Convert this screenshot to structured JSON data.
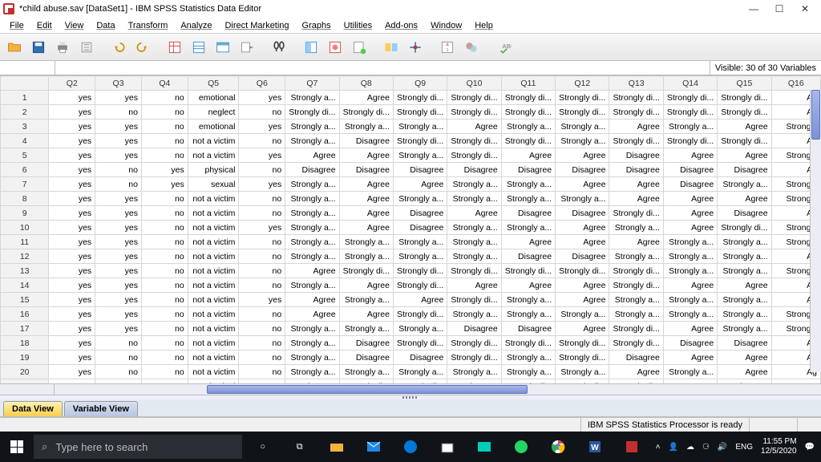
{
  "title": "*child abuse.sav [DataSet1] - IBM SPSS Statistics Data Editor",
  "menu": [
    "File",
    "Edit",
    "View",
    "Data",
    "Transform",
    "Analyze",
    "Direct Marketing",
    "Graphs",
    "Utilities",
    "Add-ons",
    "Window",
    "Help"
  ],
  "visible_text": "Visible: 30 of 30 Variables",
  "columns": [
    "Q2",
    "Q3",
    "Q4",
    "Q5",
    "Q6",
    "Q7",
    "Q8",
    "Q9",
    "Q10",
    "Q11",
    "Q12",
    "Q13",
    "Q14",
    "Q15",
    "Q16"
  ],
  "rows": [
    [
      "yes",
      "yes",
      "no",
      "emotional",
      "yes",
      "Strongly a...",
      "Agree",
      "Strongly di...",
      "Strongly di...",
      "Strongly di...",
      "Strongly di...",
      "Strongly di...",
      "Strongly di...",
      "Strongly di...",
      "Ag"
    ],
    [
      "yes",
      "no",
      "no",
      "neglect",
      "no",
      "Strongly di...",
      "Strongly di...",
      "Strongly di...",
      "Strongly di...",
      "Strongly di...",
      "Strongly di...",
      "Strongly di...",
      "Strongly di...",
      "Strongly di...",
      "Ag"
    ],
    [
      "yes",
      "yes",
      "no",
      "emotional",
      "yes",
      "Strongly a...",
      "Strongly a...",
      "Strongly a...",
      "Agree",
      "Strongly a...",
      "Strongly a...",
      "Agree",
      "Strongly a...",
      "Agree",
      "Strongly"
    ],
    [
      "yes",
      "yes",
      "no",
      "not a victim",
      "no",
      "Strongly a...",
      "Disagree",
      "Strongly di...",
      "Strongly di...",
      "Strongly di...",
      "Strongly a...",
      "Strongly di...",
      "Strongly di...",
      "Strongly di...",
      "Ag"
    ],
    [
      "yes",
      "yes",
      "no",
      "not a victim",
      "yes",
      "Agree",
      "Agree",
      "Strongly a...",
      "Strongly di...",
      "Agree",
      "Agree",
      "Disagree",
      "Agree",
      "Agree",
      "Strongly"
    ],
    [
      "yes",
      "no",
      "yes",
      "physical",
      "no",
      "Disagree",
      "Disagree",
      "Disagree",
      "Disagree",
      "Disagree",
      "Disagree",
      "Disagree",
      "Disagree",
      "Disagree",
      "Ag"
    ],
    [
      "yes",
      "no",
      "yes",
      "sexual",
      "yes",
      "Strongly a...",
      "Agree",
      "Agree",
      "Strongly a...",
      "Strongly a...",
      "Agree",
      "Agree",
      "Disagree",
      "Strongly a...",
      "Strongly"
    ],
    [
      "yes",
      "yes",
      "no",
      "not a victim",
      "no",
      "Strongly a...",
      "Agree",
      "Strongly a...",
      "Strongly a...",
      "Strongly a...",
      "Strongly a...",
      "Agree",
      "Agree",
      "Agree",
      "Strongly"
    ],
    [
      "yes",
      "yes",
      "no",
      "not a victim",
      "no",
      "Strongly a...",
      "Agree",
      "Disagree",
      "Agree",
      "Disagree",
      "Disagree",
      "Strongly di...",
      "Agree",
      "Disagree",
      "Ag"
    ],
    [
      "yes",
      "yes",
      "no",
      "not a victim",
      "yes",
      "Strongly a...",
      "Agree",
      "Disagree",
      "Strongly a...",
      "Strongly a...",
      "Agree",
      "Strongly a...",
      "Agree",
      "Strongly di...",
      "Strongly"
    ],
    [
      "yes",
      "yes",
      "no",
      "not a victim",
      "no",
      "Strongly a...",
      "Strongly a...",
      "Strongly a...",
      "Strongly a...",
      "Agree",
      "Agree",
      "Agree",
      "Strongly a...",
      "Strongly a...",
      "Strongly"
    ],
    [
      "yes",
      "yes",
      "no",
      "not a victim",
      "no",
      "Strongly a...",
      "Strongly a...",
      "Strongly a...",
      "Strongly a...",
      "Disagree",
      "Disagree",
      "Strongly a...",
      "Strongly a...",
      "Strongly a...",
      "Ag"
    ],
    [
      "yes",
      "yes",
      "no",
      "not a victim",
      "no",
      "Agree",
      "Strongly di...",
      "Strongly di...",
      "Strongly di...",
      "Strongly di...",
      "Strongly di...",
      "Strongly di...",
      "Strongly a...",
      "Strongly a...",
      "Strongly"
    ],
    [
      "yes",
      "yes",
      "no",
      "not a victim",
      "no",
      "Strongly a...",
      "Agree",
      "Strongly di...",
      "Agree",
      "Agree",
      "Agree",
      "Strongly di...",
      "Agree",
      "Agree",
      "Ag"
    ],
    [
      "yes",
      "yes",
      "no",
      "not a victim",
      "yes",
      "Agree",
      "Strongly a...",
      "Agree",
      "Strongly di...",
      "Strongly a...",
      "Agree",
      "Strongly a...",
      "Strongly a...",
      "Strongly a...",
      "Ag"
    ],
    [
      "yes",
      "yes",
      "no",
      "not a victim",
      "no",
      "Agree",
      "Agree",
      "Strongly di...",
      "Strongly a...",
      "Strongly a...",
      "Strongly a...",
      "Strongly a...",
      "Strongly a...",
      "Strongly a...",
      "Strongly"
    ],
    [
      "yes",
      "yes",
      "no",
      "not a victim",
      "no",
      "Strongly a...",
      "Strongly a...",
      "Strongly a...",
      "Disagree",
      "Disagree",
      "Agree",
      "Strongly di...",
      "Agree",
      "Strongly a...",
      "Strongly"
    ],
    [
      "yes",
      "no",
      "no",
      "not a victim",
      "no",
      "Strongly a...",
      "Disagree",
      "Strongly di...",
      "Strongly di...",
      "Strongly di...",
      "Strongly di...",
      "Strongly di...",
      "Disagree",
      "Disagree",
      "Ag"
    ],
    [
      "yes",
      "no",
      "no",
      "not a victim",
      "no",
      "Strongly a...",
      "Disagree",
      "Disagree",
      "Strongly di...",
      "Strongly a...",
      "Strongly di...",
      "Disagree",
      "Agree",
      "Agree",
      "Ag"
    ],
    [
      "yes",
      "no",
      "no",
      "not a victim",
      "no",
      "Strongly a...",
      "Strongly a...",
      "Strongly a...",
      "Strongly a...",
      "Strongly a...",
      "Strongly a...",
      "Agree",
      "Strongly a...",
      "Agree",
      "Ag"
    ],
    [
      "yes",
      "no",
      "yes",
      "physical",
      "no",
      "Disagree",
      "Strongly di...",
      "Strongly di...",
      "Disagree",
      "Strongly di...",
      "Strongly di...",
      "Strongly di...",
      "Agree",
      "Disagree",
      "Ag"
    ]
  ],
  "tabs": {
    "data": "Data View",
    "variable": "Variable View"
  },
  "status": "IBM SPSS Statistics Processor is ready",
  "search_placeholder": "Type here to search",
  "clock": {
    "time": "11:55 PM",
    "date": "12/5/2020"
  }
}
